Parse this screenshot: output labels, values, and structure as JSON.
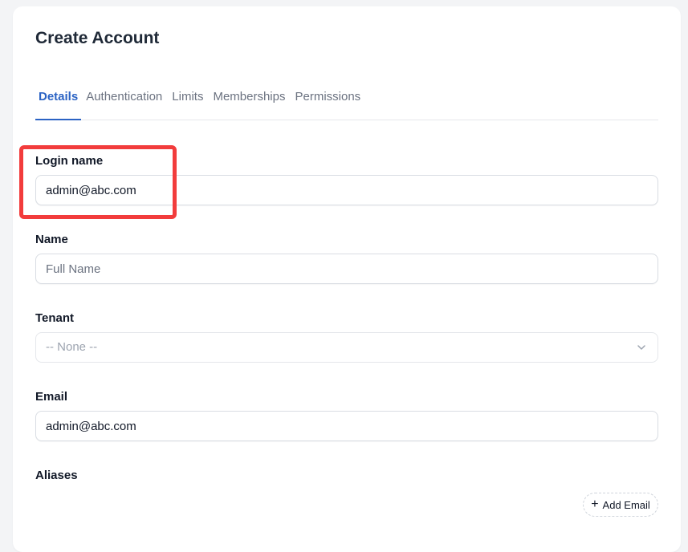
{
  "page": {
    "title": "Create Account"
  },
  "tabs": [
    {
      "label": "Details",
      "active": true
    },
    {
      "label": "Authentication",
      "active": false
    },
    {
      "label": "Limits",
      "active": false
    },
    {
      "label": "Memberships",
      "active": false
    },
    {
      "label": "Permissions",
      "active": false
    }
  ],
  "form": {
    "login_name": {
      "label": "Login name",
      "value": "admin@abc.com"
    },
    "name": {
      "label": "Name",
      "value": "",
      "placeholder": "Full Name"
    },
    "tenant": {
      "label": "Tenant",
      "selected": "-- None --"
    },
    "email": {
      "label": "Email",
      "value": "admin@abc.com"
    },
    "aliases": {
      "label": "Aliases",
      "add_button_label": "Add Email"
    }
  },
  "colors": {
    "accent": "#2b63c4",
    "highlight": "#f23c3c"
  }
}
